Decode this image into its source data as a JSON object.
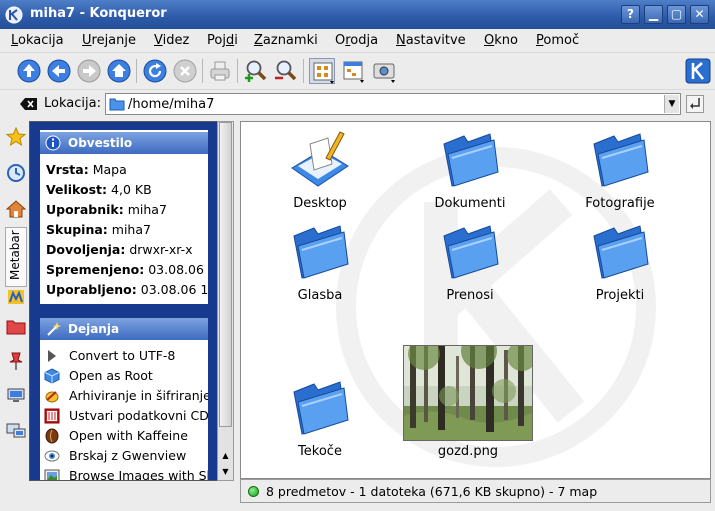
{
  "window": {
    "title": "miha7 - Konqueror",
    "buttons": [
      "?",
      "▢",
      "—",
      "▢",
      "✕"
    ]
  },
  "menu": [
    {
      "label": "Lokacija",
      "mnemonic": "L"
    },
    {
      "label": "Urejanje",
      "mnemonic": "U"
    },
    {
      "label": "Videz",
      "mnemonic": "V"
    },
    {
      "label": "Pojdi",
      "mnemonic": "d"
    },
    {
      "label": "Zaznamki",
      "mnemonic": "Z"
    },
    {
      "label": "Orodja",
      "mnemonic": "r"
    },
    {
      "label": "Nastavitve",
      "mnemonic": "N"
    },
    {
      "label": "Okno",
      "mnemonic": "O"
    },
    {
      "label": "Pomoč",
      "mnemonic": "P"
    }
  ],
  "toolbar": {
    "icons": [
      "arrow-up-icon",
      "arrow-back-icon",
      "arrow-forward-icon",
      "home-icon",
      "reload-icon",
      "stop-icon",
      "print-icon",
      "zoom-in-icon",
      "zoom-out-icon",
      "icon-view-icon",
      "tree-view-icon",
      "image-view-icon"
    ]
  },
  "location": {
    "label": "Lokacija:",
    "value": "/home/miha7"
  },
  "sidebar": {
    "tab_label": "Metabar"
  },
  "metabar": {
    "info_title": "Obvestilo",
    "info": [
      {
        "key": "Vrsta:",
        "value": "Mapa"
      },
      {
        "key": "Velikost:",
        "value": "4,0 KB"
      },
      {
        "key": "Uporabnik:",
        "value": "miha7"
      },
      {
        "key": "Skupina:",
        "value": "miha7"
      },
      {
        "key": "Dovoljenja:",
        "value": "drwxr-xr-x"
      },
      {
        "key": "Spremenjeno:",
        "value": "03.08.06"
      },
      {
        "key": "Uporabljeno:",
        "value": "03.08.06 1"
      }
    ],
    "actions_title": "Dejanja",
    "actions": [
      {
        "label": "Convert to UTF-8",
        "icon": "play-icon"
      },
      {
        "label": "Open as Root",
        "icon": "cube-icon"
      },
      {
        "label": "Arhiviranje in šifriranje",
        "icon": "archive-icon"
      },
      {
        "label": "Ustvari podatkovni CD",
        "icon": "cd-icon"
      },
      {
        "label": "Open with Kaffeine",
        "icon": "kaffeine-icon"
      },
      {
        "label": "Brskaj z Gwenview",
        "icon": "gwenview-icon"
      },
      {
        "label": "Browse Images with Sh",
        "icon": "images-icon"
      }
    ]
  },
  "files": [
    {
      "name": "Desktop",
      "type": "desktop"
    },
    {
      "name": "Dokumenti",
      "type": "folder"
    },
    {
      "name": "Fotografije",
      "type": "folder"
    },
    {
      "name": "Glasba",
      "type": "folder"
    },
    {
      "name": "Prenosi",
      "type": "folder"
    },
    {
      "name": "Projekti",
      "type": "folder"
    },
    {
      "name": "Tekoče",
      "type": "folder"
    },
    {
      "name": "gozd.png",
      "type": "image"
    }
  ],
  "status": "8 predmetov - 1 datoteka (671,6 KB skupno) - 7 map",
  "colors": {
    "titlebar": "#2c5aa8",
    "metabar_bg": "#173a8f",
    "folder_blue": "#3d8ae6"
  }
}
